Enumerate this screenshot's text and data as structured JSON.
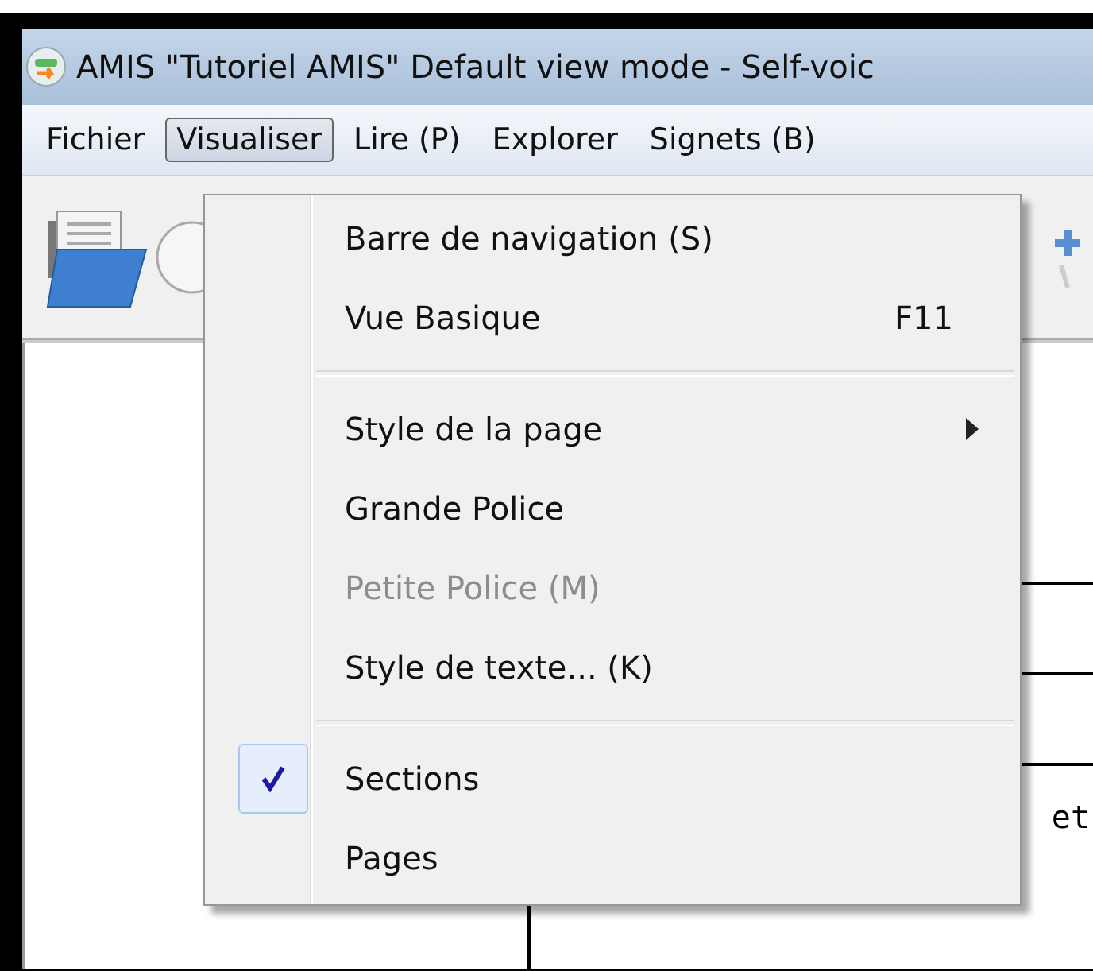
{
  "window": {
    "title": "AMIS \"Tutoriel AMIS\" Default view mode - Self-voic"
  },
  "menubar": [
    {
      "label": "Fichier",
      "selected": false
    },
    {
      "label": "Visualiser",
      "selected": true
    },
    {
      "label": "Lire (P)",
      "selected": false
    },
    {
      "label": "Explorer",
      "selected": false
    },
    {
      "label": "Signets (B)",
      "selected": false
    }
  ],
  "menu": {
    "items": [
      {
        "kind": "item",
        "label": "Barre de navigation (S)",
        "disabled": false,
        "checked": false
      },
      {
        "kind": "item",
        "label": "Vue Basique",
        "shortcut": "F11",
        "disabled": false,
        "checked": false
      },
      {
        "kind": "separator"
      },
      {
        "kind": "submenu",
        "label": "Style de la page",
        "disabled": false,
        "checked": false
      },
      {
        "kind": "item",
        "label": "Grande Police",
        "disabled": false,
        "checked": false
      },
      {
        "kind": "item",
        "label": "Petite Police (M)",
        "disabled": true,
        "checked": false
      },
      {
        "kind": "item",
        "label": "Style de texte... (K)",
        "disabled": false,
        "checked": false
      },
      {
        "kind": "separator"
      },
      {
        "kind": "item",
        "label": "Sections",
        "disabled": false,
        "checked": true
      },
      {
        "kind": "item",
        "label": "Pages",
        "disabled": false,
        "checked": false
      }
    ]
  },
  "content": {
    "text_fragment": "et"
  }
}
